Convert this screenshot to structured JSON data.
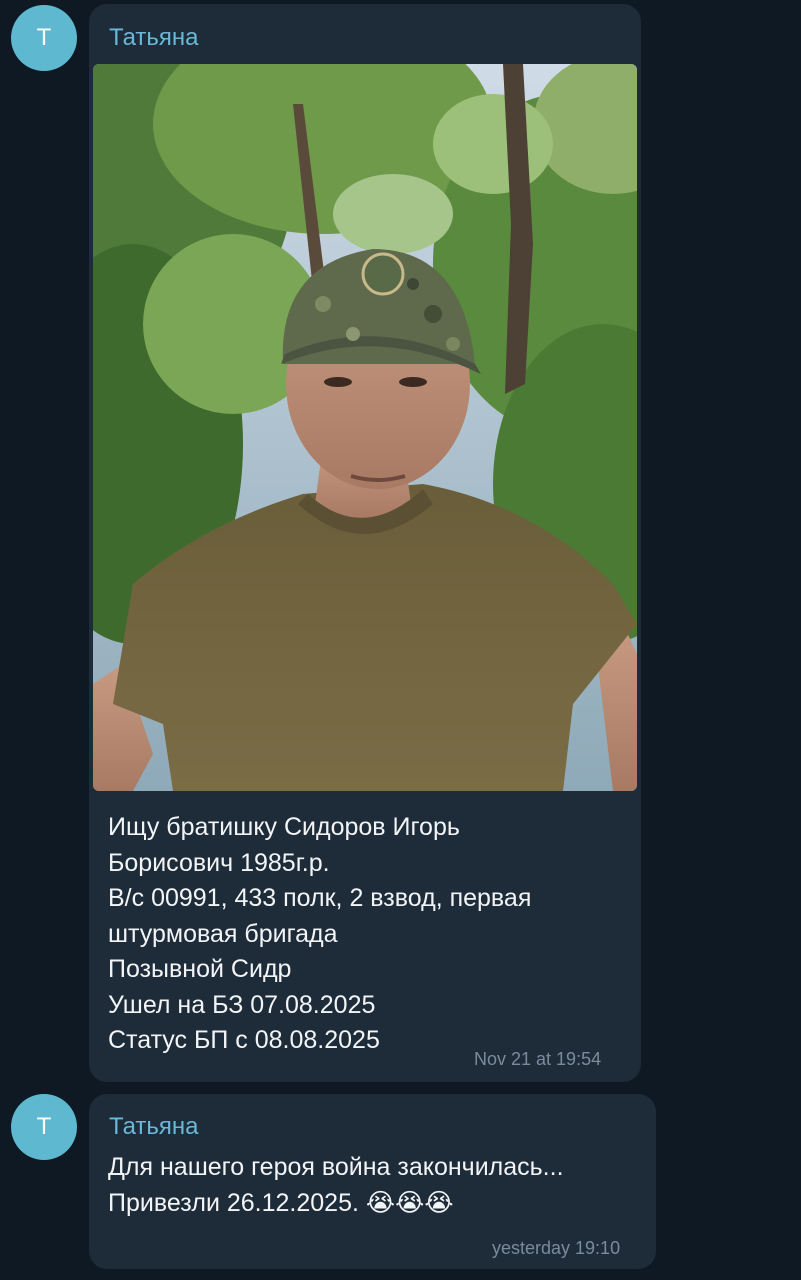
{
  "messages": [
    {
      "avatar_letter": "Т",
      "sender": "Татьяна",
      "text": "Ищу братишку Сидоров Игорь\nБорисович 1985г.р.\nВ/с 00991, 433 полк, 2 взвод, первая\nштурмовая бригада\nПозывной Сидр\nУшел на БЗ 07.08.2025\nСтатус БП с 08.08.2025",
      "time": "Nov 21 at 19:54",
      "has_photo": true
    },
    {
      "avatar_letter": "Т",
      "sender": "Татьяна",
      "text_line1": "Для нашего героя война закончилась...",
      "text_line2": "Привезли 26.12.2025. ",
      "emoji": "😭😭😭",
      "time": "yesterday 19:10"
    }
  ],
  "colors": {
    "background": "#0f1923",
    "bubble": "#1e2c3a",
    "sender_name": "#6ab8d8",
    "avatar": "#5eb9d0",
    "timestamp": "#7b8b9c"
  }
}
